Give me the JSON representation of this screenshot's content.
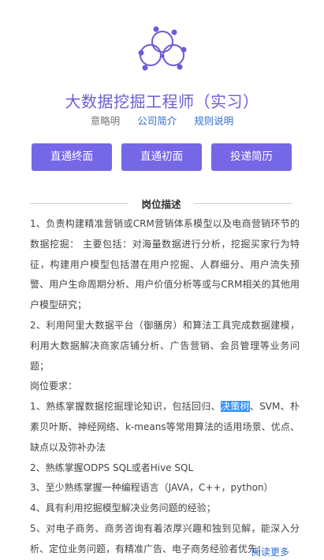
{
  "header": {
    "job_title": "大数据挖掘工程师（实习）",
    "company": "意略明",
    "links": [
      "公司简介",
      "规则说明"
    ]
  },
  "buttons": [
    "直通终面",
    "直通初面",
    "投递简历"
  ],
  "section": {
    "title": "岗位描述"
  },
  "description": {
    "p1": "1、负责构建精准营销或CRM营销体系模型以及电商营销环节的数据挖掘： 主要包括：对海量数据进行分析，挖掘买家行为特征，构建用户模型包括潜在用户挖掘、人群细分、用户流失预警、用户生命周期分析、用户价值分析等或与CRM相关的其他用户模型研究；",
    "p2": "2、利用阿里大数据平台（御膳房）和算法工具完成数据建模，利用大数据解决商家店铺分析、广告营销、会员管理等业务问题；",
    "p3": "岗位要求：",
    "p4_before": "1、熟练掌握数据挖掘理论知识，包括回归、",
    "p4_highlight": "决策树",
    "p4_after": "、SVM、朴素贝叶斯、神经网络、k-means等常用算法的适用场景、优点、缺点以及弥补办法",
    "p5": "2、熟练掌握ODPS SQL或者Hive SQL",
    "p6": "3、至少熟练掌握一种编程语言（JAVA，C++，python）",
    "p7": "4、具有利用挖掘模型解决业务问题的经验；",
    "p8": "5、对电子商务、商务咨询有着浓厚兴趣和独到见解，能深入分析、定位业务问题，有精准广告、电子商务经验者优先；"
  },
  "more_label": "阅读更多",
  "colors": {
    "accent": "#7567e6",
    "title": "#6a5cd8",
    "link": "#2f6fd1",
    "highlight": "#3390ff"
  }
}
